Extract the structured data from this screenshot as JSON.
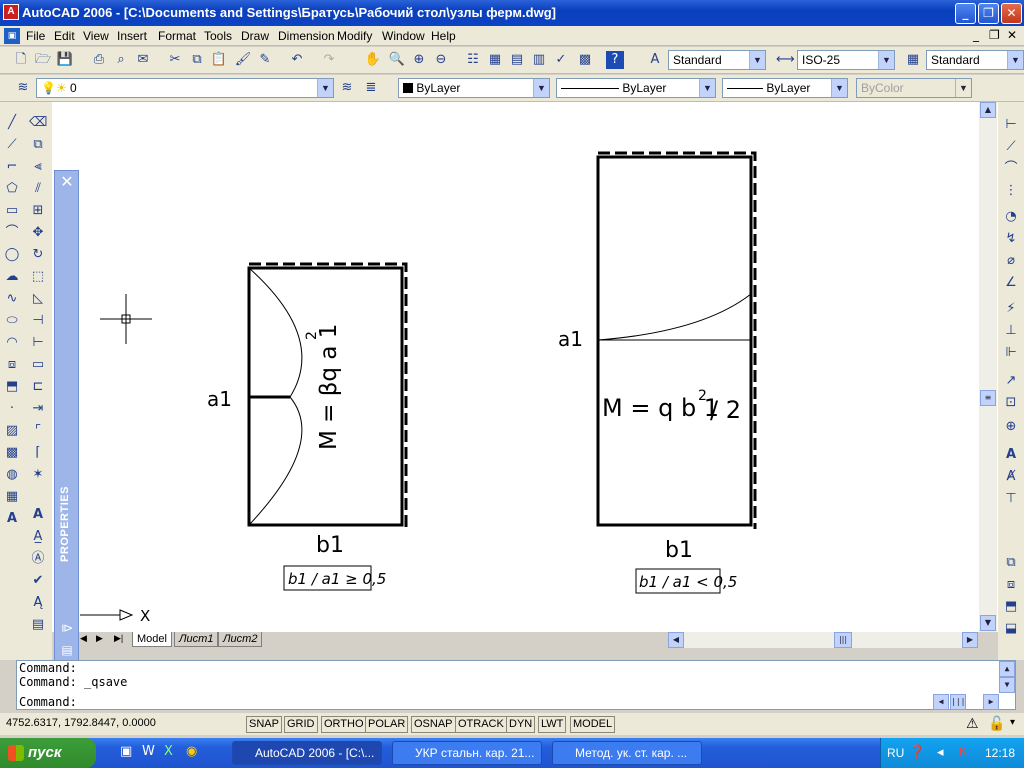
{
  "window": {
    "title": "AutoCAD 2006 - [C:\\Documents and Settings\\Братусь\\Рабочий стол\\узлы ферм.dwg]",
    "app_icon": "A"
  },
  "menu": [
    "File",
    "Edit",
    "View",
    "Insert",
    "Format",
    "Tools",
    "Draw",
    "Dimension",
    "Modify",
    "Window",
    "Help"
  ],
  "toolbar": {
    "text_style": "Standard",
    "dim_style": "ISO-25",
    "table_style": "Standard"
  },
  "layers": {
    "layer": "0",
    "color": "ByLayer",
    "linetype": "ByLayer",
    "lineweight": "ByLayer",
    "plotstyle": "ByColor"
  },
  "drawing": {
    "left": {
      "label_a": "a1",
      "label_b": "b1",
      "formula": "M = βq a 1",
      "formula_exp": "2",
      "condition": "b1 / a1 ≥ 0,5"
    },
    "right": {
      "label_a": "a1",
      "label_b": "b1",
      "formula_main": "M = q b 1",
      "formula_exp": "2",
      "formula_tail": "/ 2",
      "condition": "b1 / a1 < 0,5"
    },
    "ucs_x": "X"
  },
  "palette": {
    "title": "PROPERTIES"
  },
  "tabs": [
    "Model",
    "Лист1",
    "Лист2"
  ],
  "command": {
    "lines": [
      "Command:",
      "Command: _qsave"
    ],
    "prompt": "Command:"
  },
  "status": {
    "coords": "4752.6317, 1792.8447, 0.0000",
    "buttons": [
      "SNAP",
      "GRID",
      "ORTHO",
      "POLAR",
      "OSNAP",
      "OTRACK",
      "DYN",
      "LWT",
      "MODEL"
    ]
  },
  "taskbar": {
    "start": "пуск",
    "tasks": [
      "AutoCAD 2006 - [C:\\...",
      "УКР стальн. кар. 21...",
      "Метод. ук. ст. кар. ..."
    ],
    "lang": "RU",
    "time": "12:18"
  },
  "colors": {
    "title_blue": "#0a3fbd",
    "taskbar_blue": "#245edb",
    "start_green": "#2f8a2c",
    "palette_blue": "#9db5e8"
  }
}
